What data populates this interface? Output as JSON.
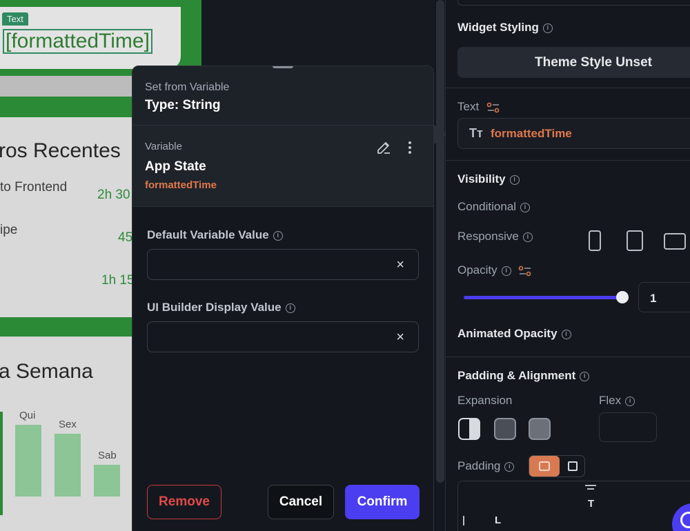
{
  "canvas": {
    "badge": "Text",
    "formatted_time": "[formattedTime]",
    "heading1": "ros Recentes",
    "item1": "to Frontend",
    "item1_time": "2h 30",
    "item2": "ipe",
    "item2_time": "45",
    "item3_time": "1h 15",
    "heading2": "a Semana",
    "bars": [
      {
        "label": "Qui",
        "value": 0.8
      },
      {
        "label": "Sex",
        "value": 0.7
      },
      {
        "label": "Sab",
        "value": 0.35
      }
    ]
  },
  "popup": {
    "subtitle": "Set from Variable",
    "type": "Type: String",
    "variable_label": "Variable",
    "variable_source": "App State",
    "variable_name": "formattedTime",
    "default_label": "Default Variable Value",
    "default_value": "",
    "ui_label": "UI Builder Display Value",
    "ui_value": "",
    "clear_icon": "×",
    "remove": "Remove",
    "cancel": "Cancel",
    "confirm": "Confirm"
  },
  "panel": {
    "widget_styling": "Widget Styling",
    "theme_button": "Theme Style Unset",
    "text_label": "Text",
    "text_icon": "Tт",
    "text_value": "formattedTime",
    "visibility": "Visibility",
    "conditional": "Conditional",
    "responsive": "Responsive",
    "opacity_label": "Opacity",
    "opacity_value": "1",
    "opacity_level": 1.0,
    "animated_opacity": "Animated Opacity",
    "padding_alignment": "Padding & Alignment",
    "expansion": "Expansion",
    "flex": "Flex",
    "padding": "Padding",
    "pad_top": "T",
    "pad_left": "L",
    "info_glyph": "i"
  },
  "colors": {
    "accent": "#4b3df0",
    "variable": "#e0784a",
    "danger": "#e04a4a",
    "canvas_green": "#2a8a35"
  }
}
